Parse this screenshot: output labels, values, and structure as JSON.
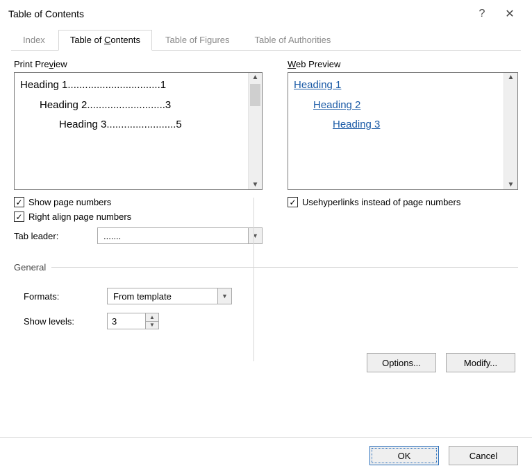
{
  "title": "Table of Contents",
  "titlebar": {
    "help_glyph": "?",
    "close_glyph": "✕"
  },
  "tabs": {
    "index": "Index",
    "toc_prefix": "Table of ",
    "toc_accel": "C",
    "toc_suffix": "ontents",
    "figures": "Table of Figures",
    "authorities": "Table of Authorities"
  },
  "print": {
    "label_prefix": "Print Pre",
    "label_accel": "v",
    "label_suffix": "iew",
    "items": [
      {
        "text": "Heading 1",
        "leader": "................................",
        "page": "1",
        "indent": "lv1"
      },
      {
        "text": "Heading 2",
        "leader": "...........................",
        "page": "3",
        "indent": "lv2"
      },
      {
        "text": "Heading 3",
        "leader": "........................",
        "page": "5",
        "indent": "lv3"
      }
    ]
  },
  "web": {
    "label_accel": "W",
    "label_suffix": "eb Preview",
    "items": [
      {
        "text": "Heading 1",
        "indent": "lv1"
      },
      {
        "text": "Heading 2",
        "indent": "lv2"
      },
      {
        "text": "Heading 3",
        "indent": "lv3"
      }
    ]
  },
  "check_show_pn": {
    "accel": "S",
    "suffix": "how page numbers",
    "checked": true
  },
  "check_right_align": {
    "accel": "R",
    "suffix": "ight align page numbers",
    "checked": true
  },
  "check_hyperlinks": {
    "prefix": "Use ",
    "accel": "h",
    "suffix": "yperlinks instead of page numbers",
    "checked": true
  },
  "tab_leader": {
    "label_prefix": "Ta",
    "label_accel": "b",
    "label_suffix": " leader:",
    "value": "......."
  },
  "general": {
    "header": "General",
    "formats_label_prefix": "Forma",
    "formats_label_accel": "t",
    "formats_label_suffix": "s:",
    "formats_value": "From template",
    "levels_label_prefix": "Show ",
    "levels_label_accel": "l",
    "levels_label_suffix": "evels:",
    "levels_value": "3"
  },
  "buttons": {
    "options_accel": "O",
    "options_suffix": "ptions...",
    "modify_accel": "M",
    "modify_suffix": "odify...",
    "ok": "OK",
    "cancel": "Cancel"
  },
  "scroll": {
    "up": "▲",
    "down": "▼"
  }
}
